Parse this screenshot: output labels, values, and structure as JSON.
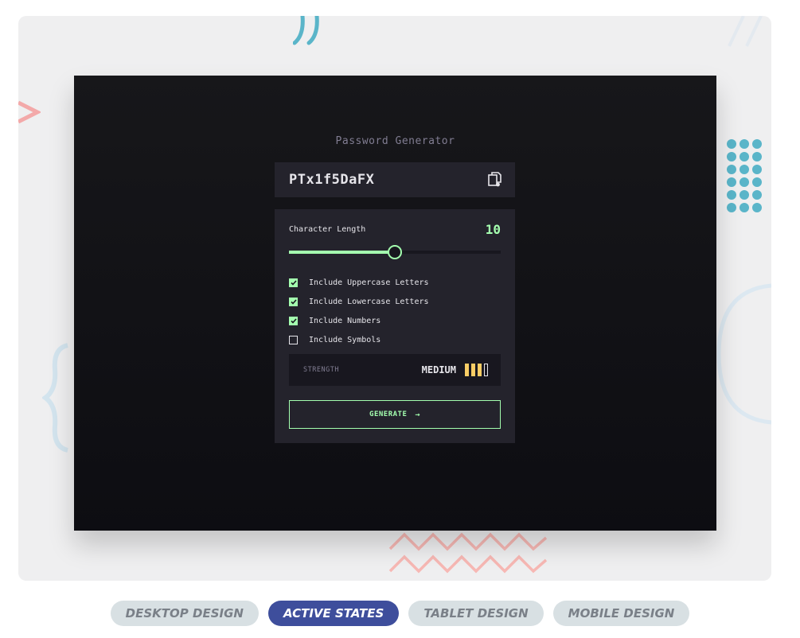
{
  "app": {
    "title": "Password Generator",
    "password": "PTx1f5DaFX",
    "copy_icon": "copy-icon"
  },
  "length": {
    "label": "Character Length",
    "value": "10",
    "fill_fraction": 0.5
  },
  "options": [
    {
      "label": "Include Uppercase Letters",
      "checked": true
    },
    {
      "label": "Include Lowercase Letters",
      "checked": true
    },
    {
      "label": "Include Numbers",
      "checked": true
    },
    {
      "label": "Include Symbols",
      "checked": false
    }
  ],
  "strength": {
    "label": "STRENGTH",
    "value": "MEDIUM",
    "bars_filled": 3,
    "bars_total": 4
  },
  "generate": {
    "label": "GENERATE",
    "icon": "arrow-right-icon"
  },
  "tabs": [
    {
      "label": "DESKTOP DESIGN",
      "active": false
    },
    {
      "label": "ACTIVE STATES",
      "active": true
    },
    {
      "label": "TABLET DESIGN",
      "active": false
    },
    {
      "label": "MOBILE DESIGN",
      "active": false
    }
  ],
  "colors": {
    "accent": "#a4ffaf",
    "strength": "#f8cd65",
    "tab_active": "#3e4e9c"
  }
}
